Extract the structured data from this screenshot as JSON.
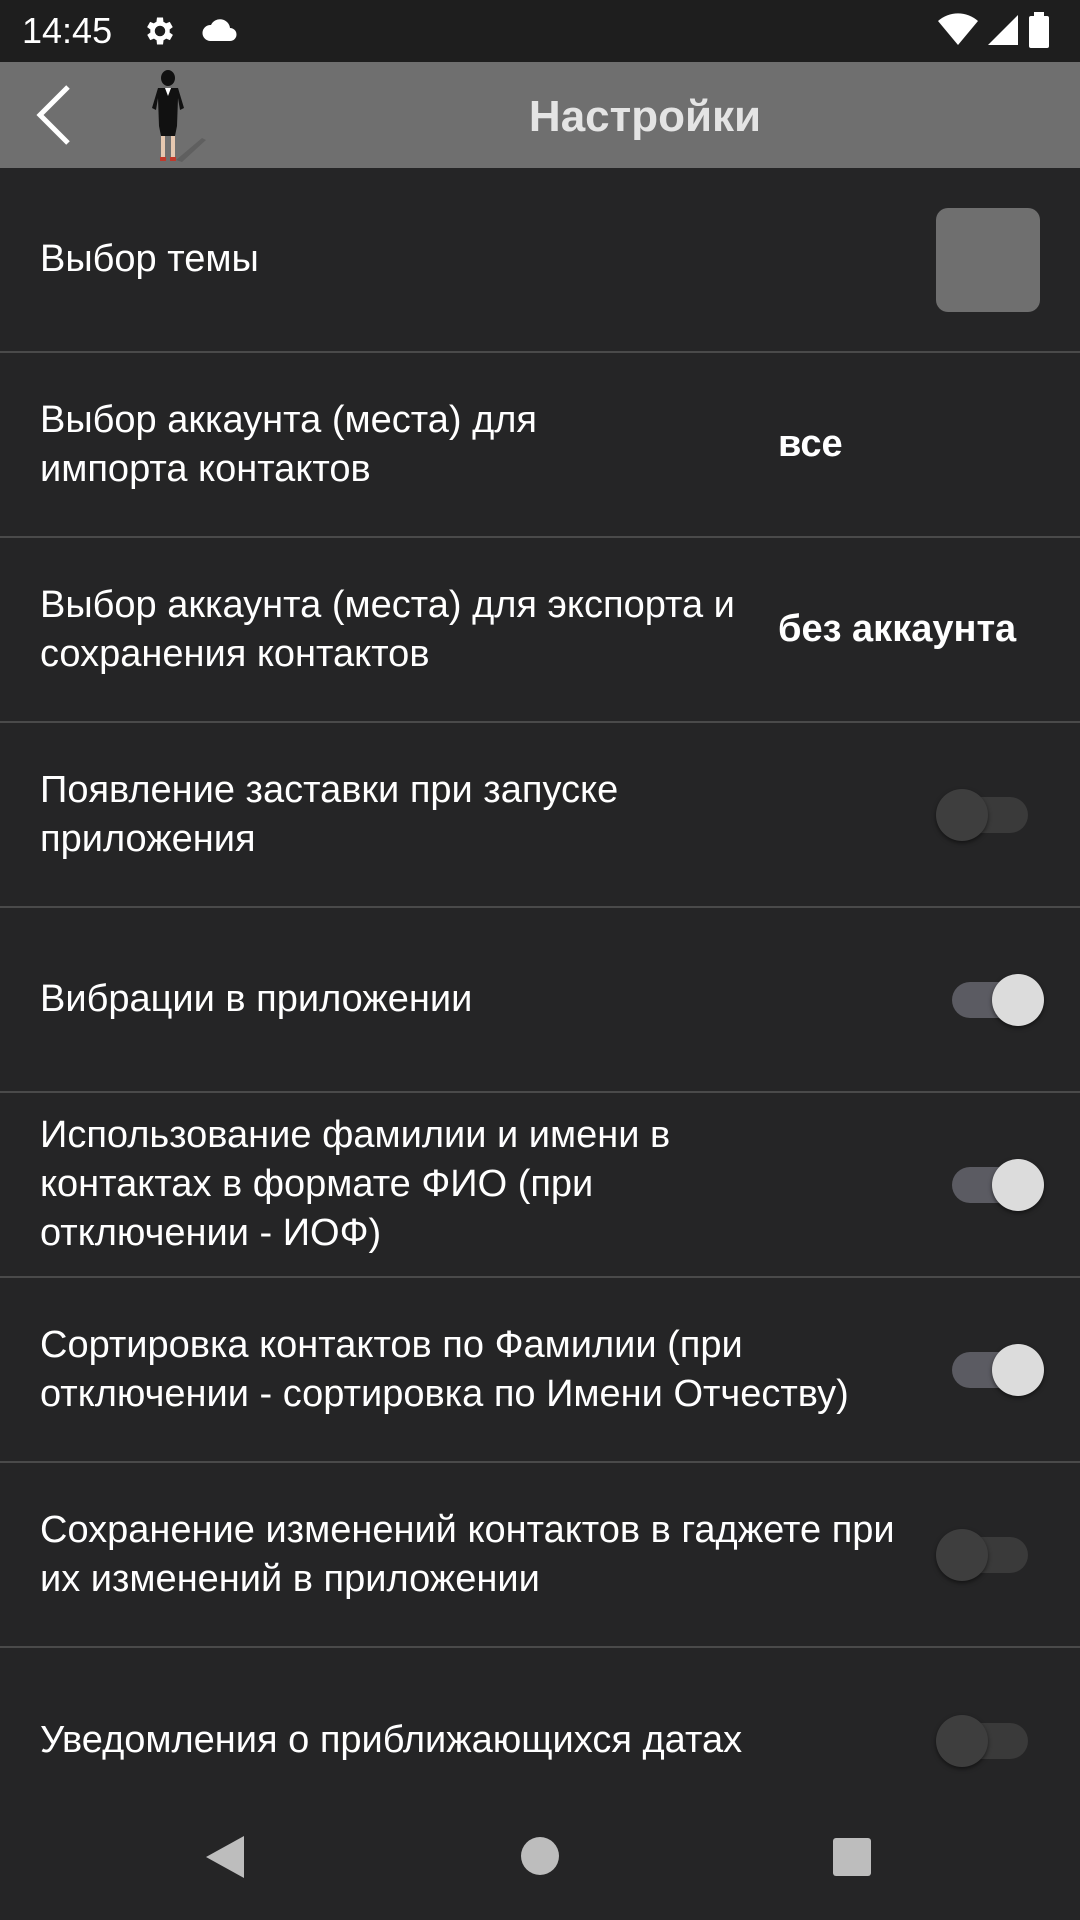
{
  "status_bar": {
    "time": "14:45",
    "icons": [
      "gear-icon",
      "cloud-icon",
      "wifi-icon",
      "signal-icon",
      "battery-icon"
    ]
  },
  "app_bar": {
    "title": "Настройки",
    "back_icon": "back-arrow-icon",
    "logo": "businesswoman-logo"
  },
  "settings": [
    {
      "label": "Выбор темы",
      "control": "theme-swatch",
      "swatch_color": "#6f6f6f"
    },
    {
      "label": "Выбор аккаунта (места) для импорта контактов",
      "control": "value",
      "value": "все"
    },
    {
      "label": "Выбор аккаунта (места) для экспорта и сохранения контактов",
      "control": "value",
      "value": "без аккаунта"
    },
    {
      "label": "Появление заставки при запуске приложения",
      "control": "toggle",
      "checked": false
    },
    {
      "label": "Вибрации в приложении",
      "control": "toggle",
      "checked": true
    },
    {
      "label": "Использование фамилии и имени в контактах в формате ФИО (при отключении - ИОФ)",
      "control": "toggle",
      "checked": true
    },
    {
      "label": "Сортировка контактов по Фамилии (при отключении - сортировка по Имени Отчеству)",
      "control": "toggle",
      "checked": true
    },
    {
      "label": "Сохранение изменений контактов в гаджете при их изменений в приложении",
      "control": "toggle",
      "checked": false
    },
    {
      "label": "Уведомления о приближающихся датах",
      "control": "toggle",
      "checked": false
    }
  ],
  "nav_bar": {
    "icons": [
      "nav-back-icon",
      "nav-home-icon",
      "nav-recents-icon"
    ]
  },
  "colors": {
    "background": "#252526",
    "app_bar": "#6f6f6f",
    "divider": "#4a4a4a",
    "toggle_on_thumb": "#dcdcdc",
    "toggle_off_thumb": "#3e3e3e"
  }
}
